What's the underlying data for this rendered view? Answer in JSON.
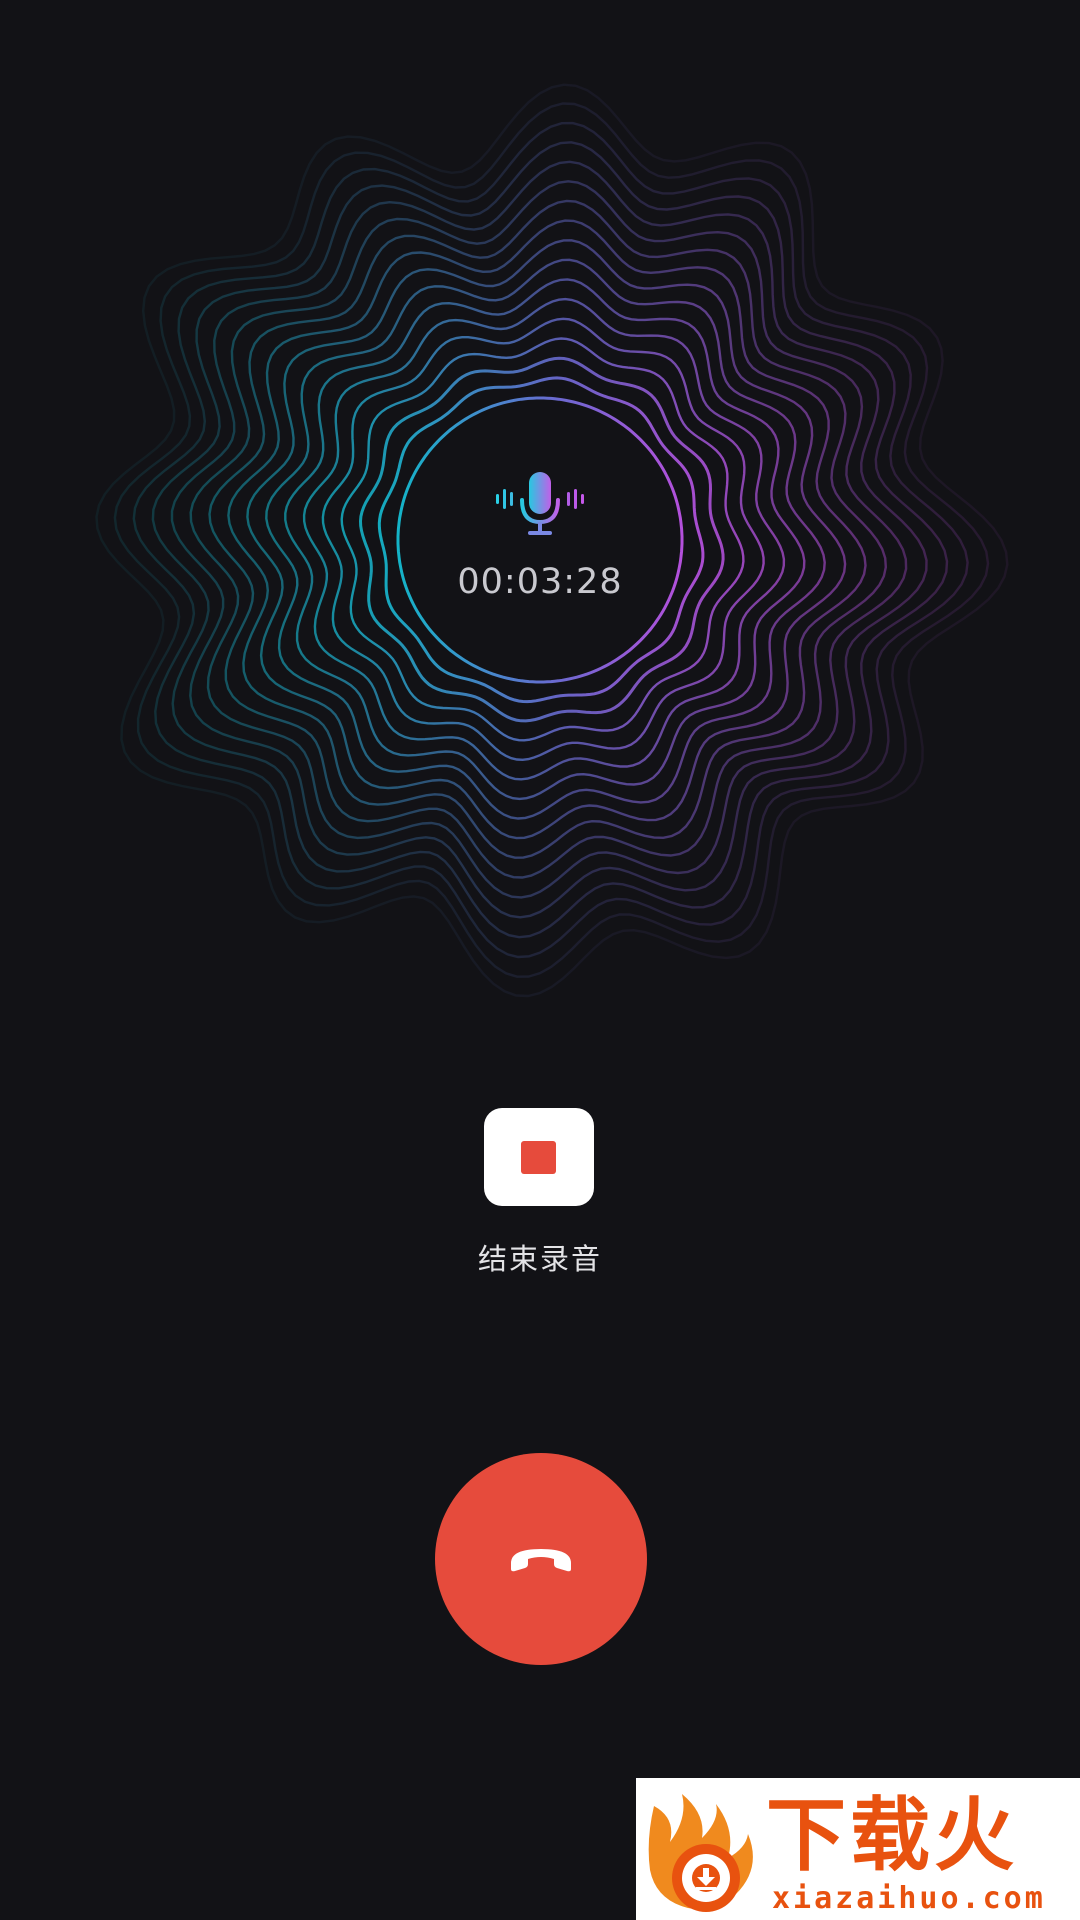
{
  "recording": {
    "elapsed_time": "00:03:28",
    "mic_icon": "microphone-icon",
    "wave_visual": "sound-wave-rings"
  },
  "controls": {
    "stop_label": "结束录音",
    "stop_icon": "stop-square-icon",
    "hangup_icon": "phone-hangup-icon"
  },
  "watermark": {
    "title": "下载火",
    "url": "xiazaihuo.com"
  },
  "colors": {
    "background": "#121216",
    "wave_cyan": "#14b4c8",
    "wave_magenta": "#b450dc",
    "danger_red": "#e64b3c",
    "watermark_orange": "#e8520f"
  }
}
